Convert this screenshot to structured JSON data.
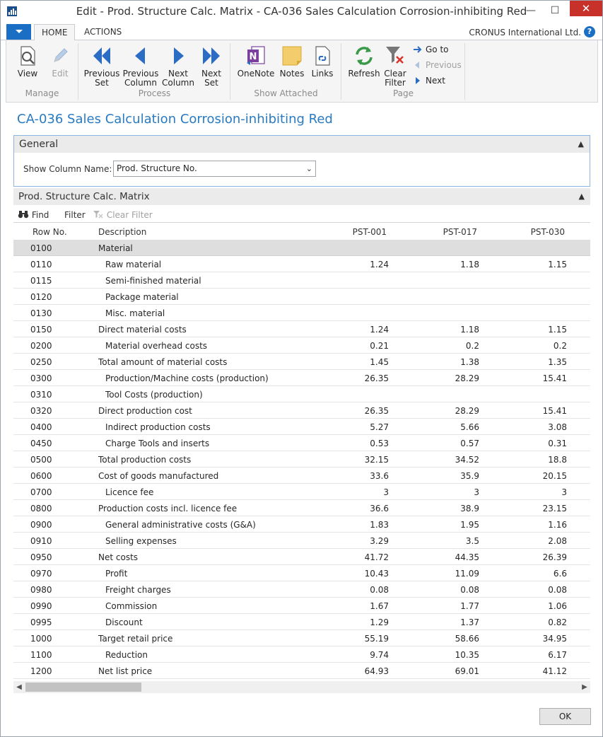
{
  "window": {
    "title": "Edit - Prod. Structure Calc. Matrix - CA-036 Sales Calculation Corrosion-inhibiting Red",
    "minimize": "—",
    "maximize": "☐",
    "close": "✕"
  },
  "ribbon_tabs": {
    "home": "HOME",
    "actions": "ACTIONS"
  },
  "company": "CRONUS International Ltd.",
  "help": "?",
  "ribbon": {
    "manage": {
      "label": "Manage",
      "view": "View",
      "edit": "Edit"
    },
    "process": {
      "label": "Process",
      "previous_set": [
        "Previous",
        "Set"
      ],
      "previous_column": [
        "Previous",
        "Column"
      ],
      "next_column": [
        "Next",
        "Column"
      ],
      "next_set": [
        "Next",
        "Set"
      ]
    },
    "show_attached": {
      "label": "Show Attached",
      "onenote": "OneNote",
      "notes": "Notes",
      "links": "Links"
    },
    "page": {
      "label": "Page",
      "refresh": "Refresh",
      "clear_filter": [
        "Clear",
        "Filter"
      ],
      "go_to": "Go to",
      "previous": "Previous",
      "next": "Next"
    }
  },
  "page_title": "CA-036 Sales Calculation Corrosion-inhibiting Red",
  "general": {
    "header": "General",
    "show_column_name_label": "Show Column Name:",
    "show_column_name_value": "Prod. Structure No."
  },
  "matrix": {
    "header": "Prod. Structure Calc. Matrix",
    "toolbar": {
      "find": "Find",
      "filter": "Filter",
      "clear_filter": "Clear Filter"
    },
    "columns": {
      "row_no": "Row No.",
      "description": "Description",
      "c1": "PST-001",
      "c2": "PST-017",
      "c3": "PST-030"
    },
    "rows": [
      {
        "no": "0100",
        "desc": "Material",
        "indent": false,
        "v1": "",
        "v2": "",
        "v3": ""
      },
      {
        "no": "0110",
        "desc": "Raw material",
        "indent": true,
        "v1": "1.24",
        "v2": "1.18",
        "v3": "1.15"
      },
      {
        "no": "0115",
        "desc": "Semi-finished material",
        "indent": true,
        "v1": "",
        "v2": "",
        "v3": ""
      },
      {
        "no": "0120",
        "desc": "Package material",
        "indent": true,
        "v1": "",
        "v2": "",
        "v3": ""
      },
      {
        "no": "0130",
        "desc": "Misc. material",
        "indent": true,
        "v1": "",
        "v2": "",
        "v3": ""
      },
      {
        "no": "0150",
        "desc": "Direct material costs",
        "indent": false,
        "v1": "1.24",
        "v2": "1.18",
        "v3": "1.15"
      },
      {
        "no": "0200",
        "desc": "Material overhead costs",
        "indent": true,
        "v1": "0.21",
        "v2": "0.2",
        "v3": "0.2"
      },
      {
        "no": "0250",
        "desc": "Total amount of material costs",
        "indent": false,
        "v1": "1.45",
        "v2": "1.38",
        "v3": "1.35"
      },
      {
        "no": "0300",
        "desc": "Production/Machine costs (production)",
        "indent": true,
        "v1": "26.35",
        "v2": "28.29",
        "v3": "15.41"
      },
      {
        "no": "0310",
        "desc": "Tool Costs (production)",
        "indent": true,
        "v1": "",
        "v2": "",
        "v3": ""
      },
      {
        "no": "0320",
        "desc": "Direct production cost",
        "indent": false,
        "v1": "26.35",
        "v2": "28.29",
        "v3": "15.41"
      },
      {
        "no": "0400",
        "desc": "Indirect production costs",
        "indent": true,
        "v1": "5.27",
        "v2": "5.66",
        "v3": "3.08"
      },
      {
        "no": "0450",
        "desc": "Charge Tools and inserts",
        "indent": true,
        "v1": "0.53",
        "v2": "0.57",
        "v3": "0.31"
      },
      {
        "no": "0500",
        "desc": "Total production costs",
        "indent": false,
        "v1": "32.15",
        "v2": "34.52",
        "v3": "18.8"
      },
      {
        "no": "0600",
        "desc": "Cost of goods manufactured",
        "indent": false,
        "v1": "33.6",
        "v2": "35.9",
        "v3": "20.15"
      },
      {
        "no": "0700",
        "desc": "Licence fee",
        "indent": true,
        "v1": "3",
        "v2": "3",
        "v3": "3"
      },
      {
        "no": "0800",
        "desc": "Production costs incl. licence fee",
        "indent": false,
        "v1": "36.6",
        "v2": "38.9",
        "v3": "23.15"
      },
      {
        "no": "0900",
        "desc": "General administrative costs (G&A)",
        "indent": true,
        "v1": "1.83",
        "v2": "1.95",
        "v3": "1.16"
      },
      {
        "no": "0910",
        "desc": "Selling expenses",
        "indent": true,
        "v1": "3.29",
        "v2": "3.5",
        "v3": "2.08"
      },
      {
        "no": "0950",
        "desc": "Net costs",
        "indent": false,
        "v1": "41.72",
        "v2": "44.35",
        "v3": "26.39"
      },
      {
        "no": "0970",
        "desc": "Profit",
        "indent": true,
        "v1": "10.43",
        "v2": "11.09",
        "v3": "6.6"
      },
      {
        "no": "0980",
        "desc": "Freight charges",
        "indent": true,
        "v1": "0.08",
        "v2": "0.08",
        "v3": "0.08"
      },
      {
        "no": "0990",
        "desc": "Commission",
        "indent": true,
        "v1": "1.67",
        "v2": "1.77",
        "v3": "1.06"
      },
      {
        "no": "0995",
        "desc": "Discount",
        "indent": true,
        "v1": "1.29",
        "v2": "1.37",
        "v3": "0.82"
      },
      {
        "no": "1000",
        "desc": "Target retail price",
        "indent": false,
        "v1": "55.19",
        "v2": "58.66",
        "v3": "34.95"
      },
      {
        "no": "1100",
        "desc": "Reduction",
        "indent": true,
        "v1": "9.74",
        "v2": "10.35",
        "v3": "6.17"
      },
      {
        "no": "1200",
        "desc": "Net list price",
        "indent": false,
        "v1": "64.93",
        "v2": "69.01",
        "v3": "41.12"
      }
    ]
  },
  "ok": "OK",
  "colors": {
    "accent": "#1a6fc5",
    "title_blue": "#2a7ac1",
    "close_red": "#c7312a"
  }
}
